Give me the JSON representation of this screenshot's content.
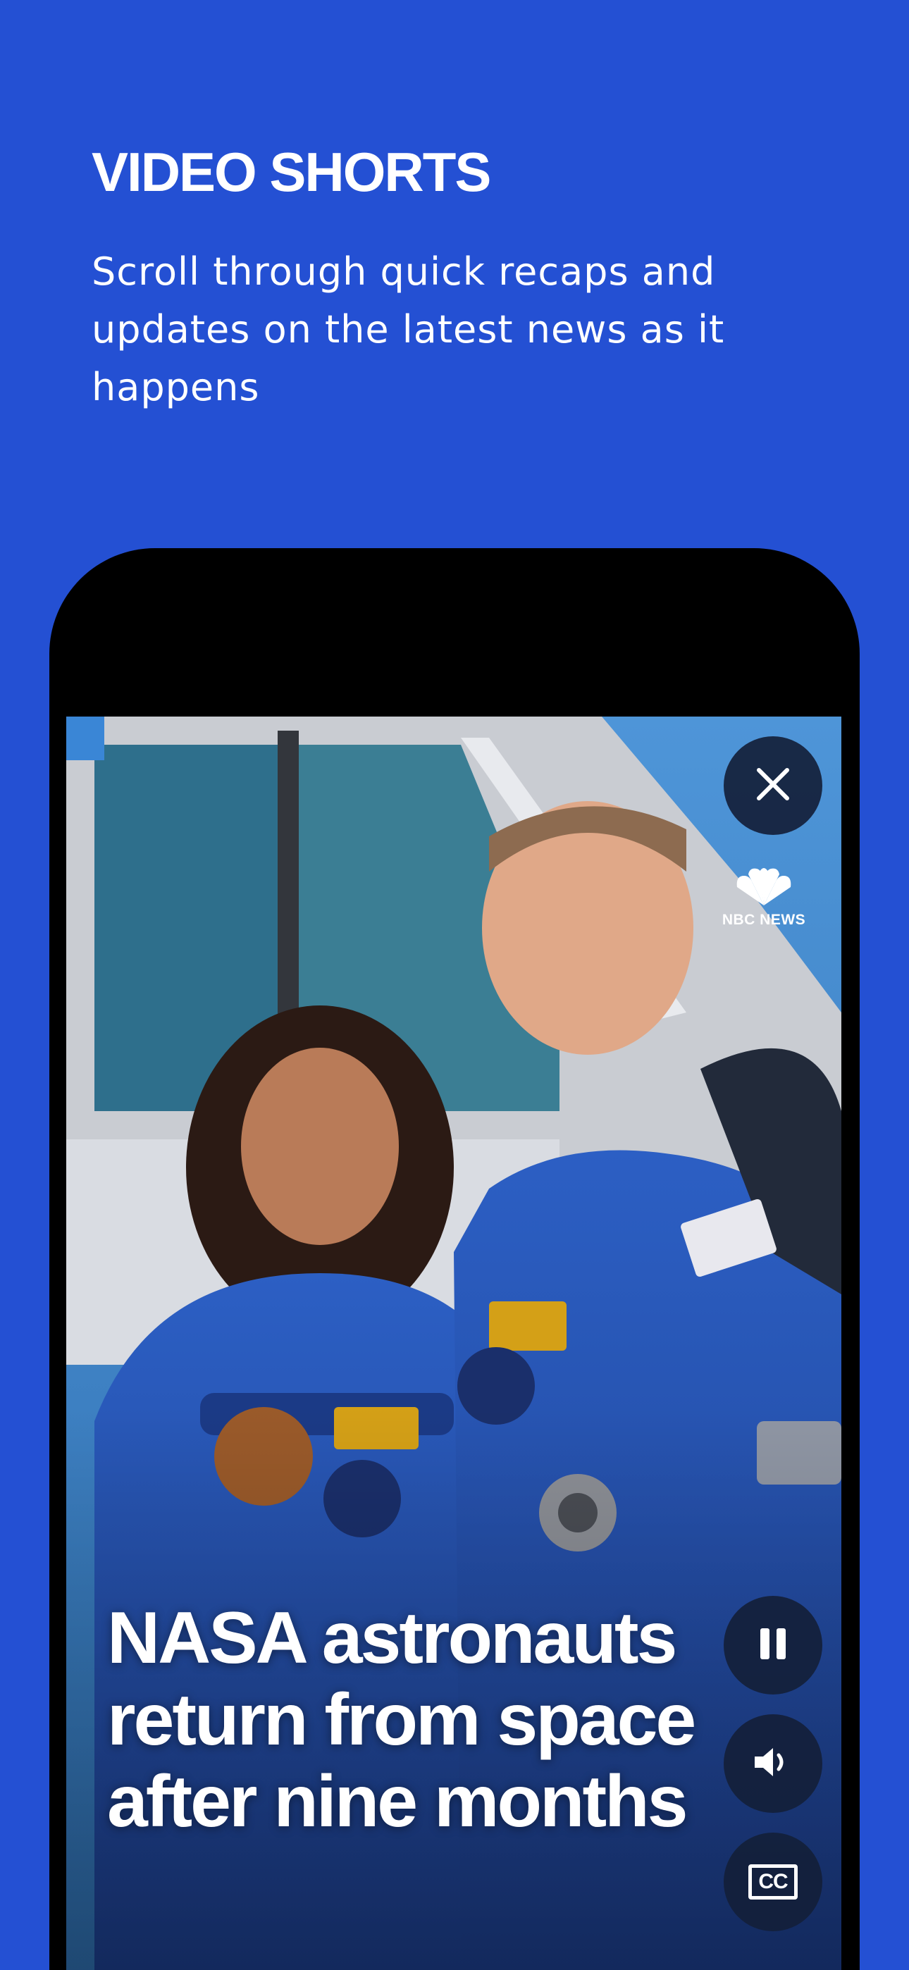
{
  "promo": {
    "title": "VIDEO SHORTS",
    "description": "Scroll through quick recaps and updates on the latest news as it happens"
  },
  "video": {
    "headline": "NASA astronauts return from space after nine months",
    "channel_logo_text": "NBC NEWS",
    "controls": {
      "close_icon": "close-icon",
      "pause_icon": "pause-icon",
      "sound_icon": "volume-icon",
      "captions_label": "CC"
    }
  },
  "colors": {
    "background": "#2450d3",
    "phone_frame": "#000000",
    "control_bg": "#14203a",
    "text": "#ffffff"
  }
}
